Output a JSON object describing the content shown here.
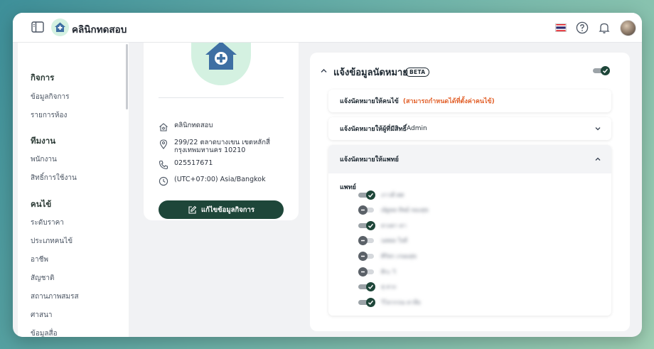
{
  "app": {
    "title": "คลินิกทดสอบ"
  },
  "sidebar": {
    "sections": [
      {
        "title": "กิจการ",
        "items": [
          "ข้อมูลกิจการ",
          "รายการห้อง"
        ]
      },
      {
        "title": "ทีมงาน",
        "items": [
          "พนักงาน",
          "สิทธิ์การใช้งาน"
        ]
      },
      {
        "title": "คนไข้",
        "items": [
          "ระดับราคา",
          "ประเภทคนไข้",
          "อาชีพ",
          "สัญชาติ",
          "สถานภาพสมรส",
          "ศาสนา",
          "ข้อมูลสื่อ"
        ]
      }
    ]
  },
  "business": {
    "name": "คลินิกทดสอบ",
    "address_line1": "299/22 ตลาดบางเขน เขตหลักสี่",
    "address_line2": "กรุงเทพมหานคร 10210",
    "phone": "025517671",
    "timezone": "(UTC+07:00) Asia/Bangkok",
    "edit_button": "แก้ไขข้อมูลกิจการ"
  },
  "appointments": {
    "title": "แจ้งข้อมูลนัดหมาย",
    "badge": "BETA",
    "enabled": true,
    "notify_patient": {
      "label": "แจ้งนัดหมายให้คนไข้",
      "note": "(สามารถกำหนดได้ที่ตั้งค่าคนไข้)"
    },
    "notify_admin": {
      "label": "แจ้งนัดหมายให้ผู้ที่มีสิทธิ์",
      "label_suffix": " Admin"
    },
    "notify_doctor": {
      "label": "แจ้งนัดหมายให้แพทย์",
      "doctor_label": "แพทย์",
      "doctors": [
        {
          "name": "ภาวดี ศศ",
          "enabled": true
        },
        {
          "name": "ณัฐพล ทิพย์ ทองสุข",
          "enabled": false
        },
        {
          "name": "ดวงตา ดา",
          "enabled": true
        },
        {
          "name": "นพพล ใจดี",
          "enabled": false
        },
        {
          "name": "ศิริพร เกษมสุข",
          "enabled": false
        },
        {
          "name": "ศิระ วิ",
          "enabled": false
        },
        {
          "name": "สุ ดวง",
          "enabled": true
        },
        {
          "name": "วิไลวรรณ ดาลีย",
          "enabled": true
        }
      ]
    }
  }
}
